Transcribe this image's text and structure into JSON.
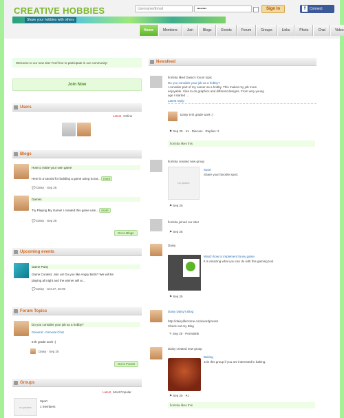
{
  "header": {
    "logo": "CREATIVE HOBBIES",
    "tagline": "Share your hobbies with others",
    "username_placeholder": "Username/Email",
    "password_value": "••••••••",
    "signin_label": "Sign In",
    "facebook_label": "Connect",
    "facebook_icon": "f"
  },
  "nav": [
    "Home",
    "Members",
    "Join",
    "Blogs",
    "Events",
    "Forum",
    "Groups",
    "Links",
    "Photo",
    "Chat",
    "Video"
  ],
  "welcome": "Welcome to our new site! Feel free to participate in our community!",
  "join_label": "Join Now",
  "users": {
    "title": "Users",
    "tab_latest": "Latest",
    "tab_online": "Online"
  },
  "blogs": {
    "title": "Blogs",
    "items": [
      {
        "title": "How to make your own game",
        "excerpt": "Here is a tutorial for building a game using Scrat...",
        "more": "more",
        "author": "Daisy",
        "date": "Sep 25"
      },
      {
        "title": "Games",
        "excerpt": "Try Playing My Game! I created this game usin...",
        "more": "more",
        "author": "Daisy",
        "date": "Sep 25"
      }
    ],
    "button": "Go to Blogs"
  },
  "events": {
    "title": "Upcoming events",
    "name": "Game Party",
    "text1": "Game Contest. Join us! Do you like Angry Birds? We will be",
    "text2": "playing all night and the winner will w...",
    "author": "Daisy",
    "date": "Oct 27, 20:00"
  },
  "forum": {
    "title": "Forum Topics",
    "topic": "Do you consider your job as a hobby?",
    "crumb": "General › General Chat",
    "reply": "5-th grade work :)",
    "author": "Daisy",
    "date": "Sep 25",
    "button": "Go to Forum"
  },
  "groups": {
    "title": "Groups",
    "tab_latest": "Latest",
    "tab_popular": "Most Popular",
    "name": "Sport",
    "members": "1 members",
    "pic": "no picture"
  },
  "newsfeed": {
    "title": "Newsfeed",
    "f1": {
      "actor": "fiori4ka liked Daisy's forum topic",
      "q": "Do you consider your job as a hobby?",
      "b1": "I consider part of my career as a hobby. This makes my job more",
      "b2": "enjoyable. I like to do graphics and different designs. From very young",
      "b3": "age I started ...",
      "latest": "Latest reply:",
      "reply": "Daisy 5-th grade work :)",
      "date": "Sep 25",
      "likes": "1",
      "discuss": "Discuss",
      "replies": "Replies: 2",
      "liked": "fiori4ka likes this"
    },
    "f2": {
      "actor": "fiori4ka created new group",
      "name": "Sport",
      "desc": "Share your favorite sport.",
      "pic": "no picture",
      "date": "Sep 25"
    },
    "f3": {
      "actor": "fiori4ka joined our site!",
      "date": "Sep 25"
    },
    "f4": {
      "actor": "Daisy",
      "l1": "Watch how to implement funny game",
      "l2": "It is amazing what you can do with this gaming tool.",
      "date": "Sep 25"
    },
    "f5": {
      "actor": "Daisy Daisy's Blog",
      "link": "http://daisyliferrome.com/wordpress1",
      "check": "Check out my Blog",
      "date": "Sep 25",
      "permalink": "Permalink"
    },
    "f6": {
      "actor": "Daisy created new group",
      "name": "Baking",
      "desc": "Join this group if you are interested in baking.",
      "date": "Sep 25",
      "likes": "1",
      "liked": "fiori4ka likes this"
    }
  }
}
